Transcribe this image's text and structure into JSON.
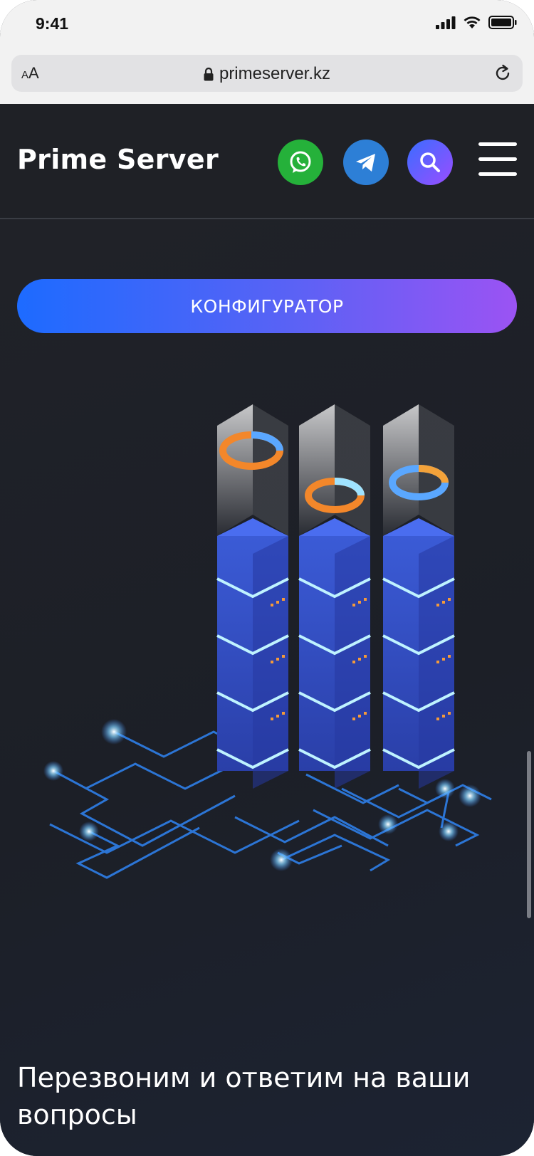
{
  "status_bar": {
    "time": "9:41"
  },
  "browser": {
    "text_size_label_small": "A",
    "text_size_label_large": "A",
    "url": "primeserver.kz"
  },
  "header": {
    "logo": "Prime Server",
    "icons": [
      "whatsapp-icon",
      "telegram-icon",
      "search-icon",
      "menu-icon"
    ]
  },
  "hero": {
    "configurator_button": "КОНФИГУРАТОР",
    "heading": "Перезвоним и ответим на ваши вопросы"
  },
  "colors": {
    "whatsapp": "#25b13a",
    "telegram": "#2d7fd6",
    "gradient_start": "#1d6bff",
    "gradient_end": "#9b53f3",
    "background": "#1f2126"
  }
}
